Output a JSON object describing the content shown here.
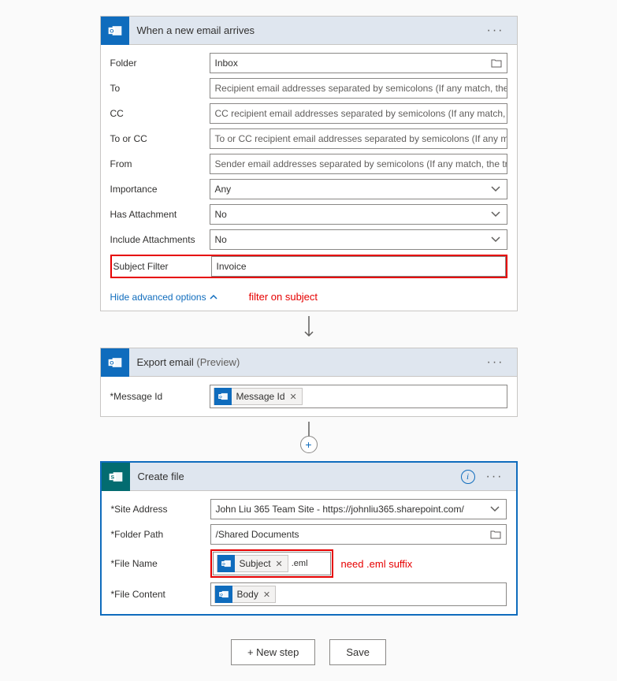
{
  "card1": {
    "title": "When a new email arrives",
    "rows": {
      "folder_label": "Folder",
      "folder_value": "Inbox",
      "to_label": "To",
      "to_placeholder": "Recipient email addresses separated by semicolons (If any match, the trigger ...",
      "cc_label": "CC",
      "cc_placeholder": "CC recipient email addresses separated by semicolons (If any match, the trigg...",
      "toorcc_label": "To or CC",
      "toorcc_placeholder": "To or CC recipient email addresses separated by semicolons (If any match, th...",
      "from_label": "From",
      "from_placeholder": "Sender email addresses separated by semicolons (If any match, the trigger wi...",
      "importance_label": "Importance",
      "importance_value": "Any",
      "hasatt_label": "Has Attachment",
      "hasatt_value": "No",
      "incatt_label": "Include Attachments",
      "incatt_value": "No",
      "subfilter_label": "Subject Filter",
      "subfilter_value": "Invoice"
    },
    "hide_link": "Hide advanced options",
    "annotation": "filter on subject"
  },
  "card2": {
    "title": "Export email",
    "preview": "(Preview)",
    "msgid_label": "Message Id",
    "msgid_token": "Message Id"
  },
  "card3": {
    "title": "Create file",
    "site_label": "Site Address",
    "site_value": "John Liu 365 Team Site - https://johnliu365.sharepoint.com/",
    "folder_label": "Folder Path",
    "folder_value": "/Shared Documents",
    "filename_label": "File Name",
    "filename_token": "Subject",
    "filename_suffix": ".eml",
    "filecontent_label": "File Content",
    "filecontent_token": "Body",
    "annotation": "need .eml suffix"
  },
  "footer": {
    "newstep": "+ New step",
    "save": "Save"
  }
}
